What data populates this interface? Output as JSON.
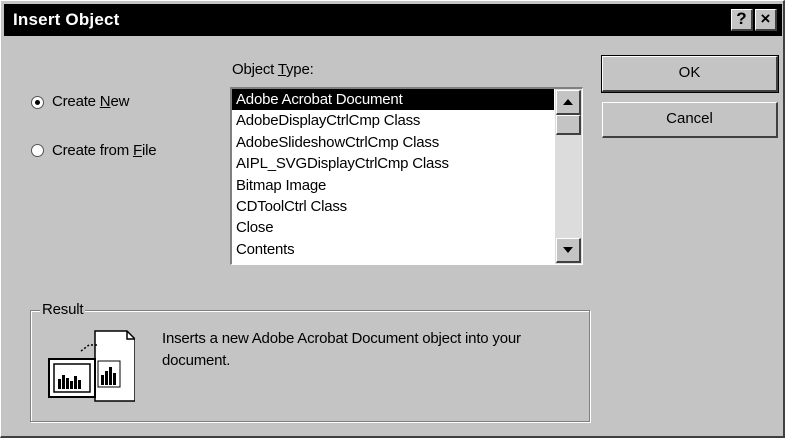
{
  "dialog": {
    "title": "Insert Object",
    "help_button": "?",
    "close_button": "×"
  },
  "options": {
    "create_new": {
      "pre": "Create ",
      "accel": "N",
      "post": "ew",
      "selected": true
    },
    "create_from_file": {
      "pre": "Create from ",
      "accel": "F",
      "post": "ile",
      "selected": false
    }
  },
  "object_type": {
    "label_pre": "Object ",
    "label_accel": "T",
    "label_post": "ype:",
    "selected_index": 0,
    "items": [
      "Adobe Acrobat Document",
      "AdobeDisplayCtrlCmp Class",
      "AdobeSlideshowCtrlCmp Class",
      "AIPL_SVGDisplayCtrlCmp Class",
      "Bitmap Image",
      "CDToolCtrl Class",
      "Close",
      "Contents"
    ]
  },
  "buttons": {
    "ok": "OK",
    "cancel": "Cancel"
  },
  "result": {
    "title": "Result",
    "description": "Inserts a new Adobe Acrobat Document object into your document.",
    "icon": "insert-object-result-icon"
  },
  "colors": {
    "face": "#c4c4c4",
    "titlebar": "#000000",
    "selection": "#000000"
  }
}
